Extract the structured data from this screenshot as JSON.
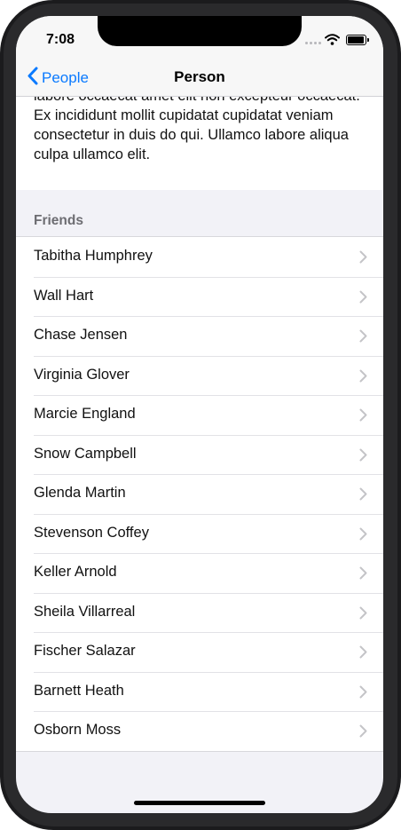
{
  "status": {
    "time": "7:08"
  },
  "nav": {
    "back_label": "People",
    "title": "Person"
  },
  "description": "labore occaecat amet elit non excepteur occaecat. Ex incididunt mollit cupidatat cupidatat veniam consectetur in duis do qui. Ullamco labore aliqua culpa ullamco elit.",
  "friends": {
    "header": "Friends",
    "items": [
      {
        "name": "Tabitha Humphrey"
      },
      {
        "name": "Wall Hart"
      },
      {
        "name": "Chase Jensen"
      },
      {
        "name": "Virginia Glover"
      },
      {
        "name": "Marcie England"
      },
      {
        "name": "Snow Campbell"
      },
      {
        "name": "Glenda Martin"
      },
      {
        "name": "Stevenson Coffey"
      },
      {
        "name": "Keller Arnold"
      },
      {
        "name": "Sheila Villarreal"
      },
      {
        "name": "Fischer Salazar"
      },
      {
        "name": "Barnett Heath"
      },
      {
        "name": "Osborn Moss"
      }
    ]
  },
  "colors": {
    "accent": "#0a7aff",
    "background": "#f2f2f7",
    "chevron": "#c4c4c7"
  },
  "icons": {
    "back": "chevron-left-icon",
    "row": "chevron-right-icon",
    "wifi": "wifi-icon",
    "battery": "battery-icon"
  }
}
